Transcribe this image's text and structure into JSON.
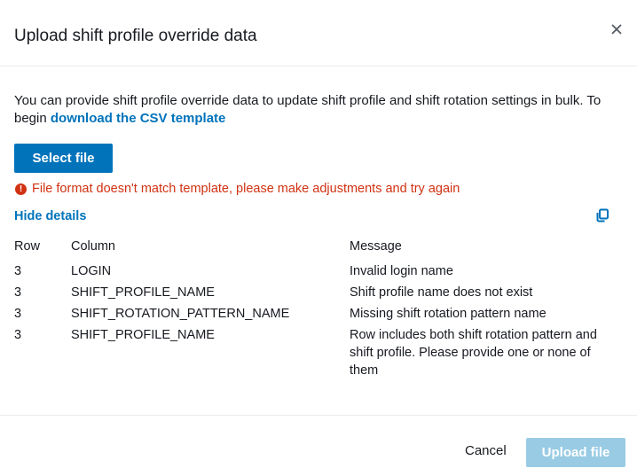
{
  "dialog": {
    "title": "Upload shift profile override data",
    "close_icon": "close-icon",
    "description_text": "You can provide shift profile override data to update shift profile and shift rotation settings in bulk. To begin ",
    "template_link": "download the CSV template",
    "select_file_label": "Select file",
    "error_icon": "exclamation-circle-icon",
    "error_message": "File format doesn't match template, please make adjustments and try again",
    "hide_details_label": "Hide details",
    "copy_icon": "copy-icon"
  },
  "errors_table": {
    "headers": [
      "Row",
      "Column",
      "Message"
    ],
    "rows": [
      {
        "row": "3",
        "column": "LOGIN",
        "message": "Invalid login name"
      },
      {
        "row": "3",
        "column": "SHIFT_PROFILE_NAME",
        "message": "Shift profile name does not exist"
      },
      {
        "row": "3",
        "column": "SHIFT_ROTATION_PATTERN_NAME",
        "message": "Missing shift rotation pattern name"
      },
      {
        "row": "3",
        "column": "SHIFT_PROFILE_NAME",
        "message": "Row includes both shift rotation pattern and shift profile. Please provide one or none of them"
      }
    ]
  },
  "footer": {
    "cancel_label": "Cancel",
    "upload_label": "Upload file"
  },
  "colors": {
    "primary": "#0073bb",
    "primary_disabled": "#99cbe4",
    "error": "#d13212"
  }
}
